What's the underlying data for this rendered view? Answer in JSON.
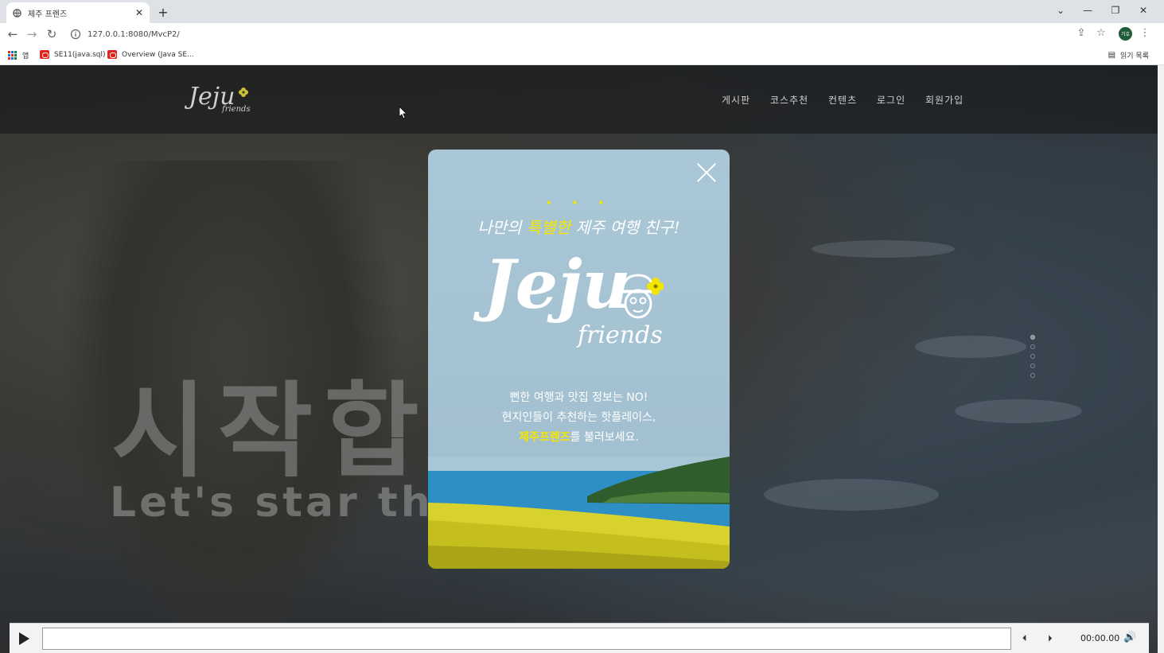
{
  "browser": {
    "tab_title": "제주 프렌즈",
    "tab_close": "✕",
    "new_tab": "+",
    "url": "127.0.0.1:8080/MvcP2/",
    "profile": "기호",
    "window_controls": {
      "dropdown": "⌄",
      "minimize": "—",
      "restore": "❐",
      "close": "✕"
    },
    "nav": {
      "back": "←",
      "forward": "→",
      "reload": "↻"
    },
    "toolbar_icons": {
      "share": "⇪",
      "star": "☆",
      "more": "⋮"
    },
    "bookmarks": [
      {
        "label": "앱",
        "icon": "apps-icon"
      },
      {
        "label": "SE11(java.sql)",
        "icon": "oracle-icon"
      },
      {
        "label": "Overview (Java SE...",
        "icon": "oracle-icon"
      }
    ],
    "reading_list": "읽기 목록"
  },
  "site": {
    "logo_main": "Jeju",
    "logo_sub": "friends",
    "menu": [
      "게시판",
      "코스추천",
      "컨텐츠",
      "로그인",
      "회원가입"
    ],
    "hero_ko": "시작합니",
    "hero_en": "Let's star the"
  },
  "popup": {
    "tagline_before": "나만의 ",
    "tagline_highlight": "특별한",
    "tagline_after": " 제주 여행 친구!",
    "tagline_dots": "• • •",
    "logo_main": "Jeju",
    "logo_sub": "friends",
    "line1": "뻔한 여행과 맛집 정보는 NO!",
    "line2": "현지인들이 추천하는 핫플레이스,",
    "line3_brand": "제주프렌즈",
    "line3_rest": "를 불러보세요."
  },
  "player": {
    "time": "00:00.00",
    "prev": "⏴",
    "next": "⏵",
    "volume": "🔊"
  },
  "colors": {
    "accent_yellow": "#f5e600",
    "popup_sky": "#a9c7d6"
  }
}
